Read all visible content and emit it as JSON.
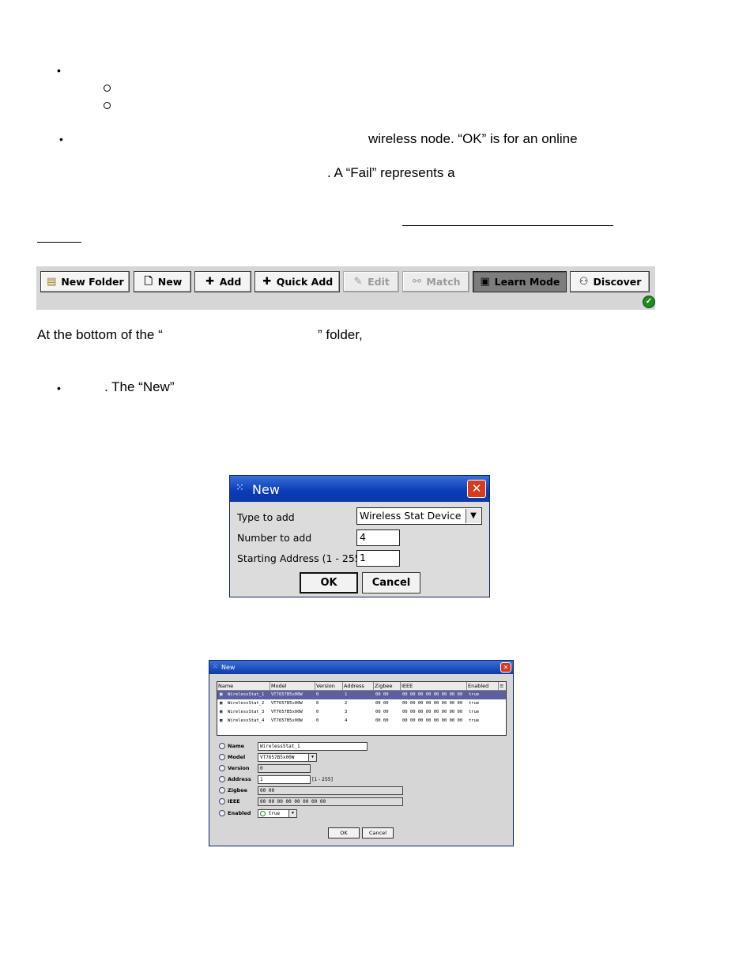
{
  "doc": {
    "line1": "wireless node. “OK” is for an online",
    "line2": ". A “Fail” represents a",
    "line3": "At the bottom of the “",
    "line3b": "” folder,",
    "line4": ". The “New”"
  },
  "toolbar": {
    "buttons": [
      {
        "label": "New Folder",
        "icon": "folder-icon"
      },
      {
        "label": "New",
        "icon": "new-document-icon"
      },
      {
        "label": "Add",
        "icon": "plus-icon"
      },
      {
        "label": "Quick Add",
        "icon": "plus-icon"
      },
      {
        "label": "Edit",
        "icon": "edit-icon"
      },
      {
        "label": "Match",
        "icon": "match-icon"
      },
      {
        "label": "Learn Mode",
        "icon": "learn-mode-icon"
      },
      {
        "label": "Discover",
        "icon": "binoculars-icon"
      }
    ],
    "status": "✓"
  },
  "dialog1": {
    "title": "New",
    "type_label": "Type to add",
    "type_value": "Wireless Stat Device",
    "number_label": "Number to add",
    "number_value": "4",
    "start_label": "Starting Address (1 - 255)",
    "start_value": "1",
    "ok": "OK",
    "cancel": "Cancel"
  },
  "dialog2": {
    "title": "New",
    "columns": [
      "Name",
      "Model",
      "Version",
      "Address",
      "Zigbee",
      "IEEE",
      "Enabled"
    ],
    "rows": [
      [
        "WirelessStat_1",
        "VT7657B5x00W",
        "0",
        "1",
        "00 00",
        "00 00 00 00 00 00 00 00",
        "true"
      ],
      [
        "WirelessStat_2",
        "VT7657B5x00W",
        "0",
        "2",
        "00 00",
        "00 00 00 00 00 00 00 00",
        "true"
      ],
      [
        "WirelessStat_3",
        "VT7657B5x00W",
        "0",
        "3",
        "00 00",
        "00 00 00 00 00 00 00 00",
        "true"
      ],
      [
        "WirelessStat_4",
        "VT7657B5x00W",
        "0",
        "4",
        "00 00",
        "00 00 00 00 00 00 00 00",
        "true"
      ]
    ],
    "props": {
      "name_label": "Name",
      "name_value": "WirelessStat_1",
      "model_label": "Model",
      "model_value": "VT7657B5x00W",
      "version_label": "Version",
      "version_value": "0",
      "address_label": "Address",
      "address_value": "1",
      "address_range": "[1 - 255]",
      "zigbee_label": "Zigbee",
      "zigbee_value": "00 00",
      "ieee_label": "IEEE",
      "ieee_value": "00 00 00 00 00 00 00 00",
      "enabled_label": "Enabled",
      "enabled_value": "true"
    },
    "ok": "OK",
    "cancel": "Cancel"
  }
}
